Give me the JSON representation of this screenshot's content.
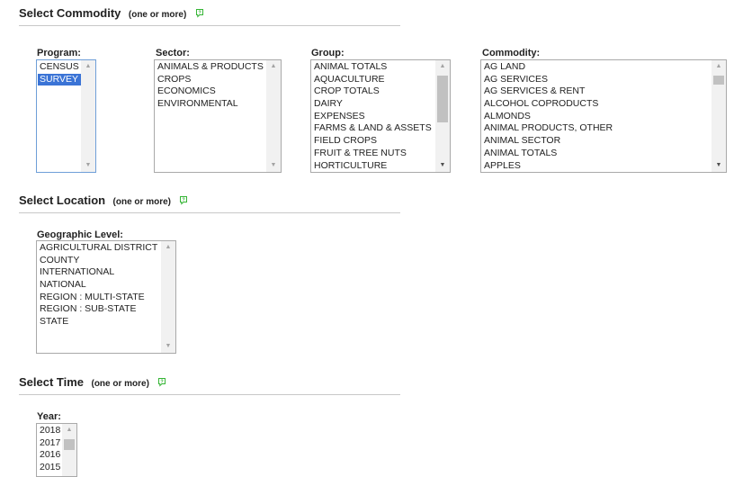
{
  "commodity_section": {
    "title": "Select Commodity",
    "note": "(one or more)",
    "program": {
      "label": "Program:",
      "options": [
        "CENSUS",
        "SURVEY"
      ],
      "selected": "SURVEY"
    },
    "sector": {
      "label": "Sector:",
      "options": [
        "ANIMALS & PRODUCTS",
        "CROPS",
        "ECONOMICS",
        "ENVIRONMENTAL"
      ]
    },
    "group": {
      "label": "Group:",
      "options": [
        "ANIMAL TOTALS",
        "AQUACULTURE",
        "CROP TOTALS",
        "DAIRY",
        "EXPENSES",
        "FARMS & LAND & ASSETS",
        "FIELD CROPS",
        "FRUIT & TREE NUTS",
        "HORTICULTURE"
      ]
    },
    "commodity": {
      "label": "Commodity:",
      "options": [
        "AG LAND",
        "AG SERVICES",
        "AG SERVICES & RENT",
        "ALCOHOL COPRODUCTS",
        "ALMONDS",
        "ANIMAL PRODUCTS, OTHER",
        "ANIMAL SECTOR",
        "ANIMAL TOTALS",
        "APPLES"
      ]
    }
  },
  "location_section": {
    "title": "Select Location",
    "note": "(one or more)",
    "geographic_level": {
      "label": "Geographic Level:",
      "options": [
        "AGRICULTURAL DISTRICT",
        "COUNTY",
        "INTERNATIONAL",
        "NATIONAL",
        "REGION : MULTI-STATE",
        "REGION : SUB-STATE",
        "STATE"
      ]
    }
  },
  "time_section": {
    "title": "Select Time",
    "note": "(one or more)",
    "year": {
      "label": "Year:",
      "options": [
        "2018",
        "2017",
        "2016",
        "2015"
      ]
    }
  },
  "colors": {
    "help_icon": "#35b535",
    "selection": "#3b74d6",
    "focus_border": "#6f9fd8"
  },
  "icons": {
    "help": "help-icon",
    "scroll_up": "triangle-up",
    "scroll_down": "triangle-down"
  }
}
